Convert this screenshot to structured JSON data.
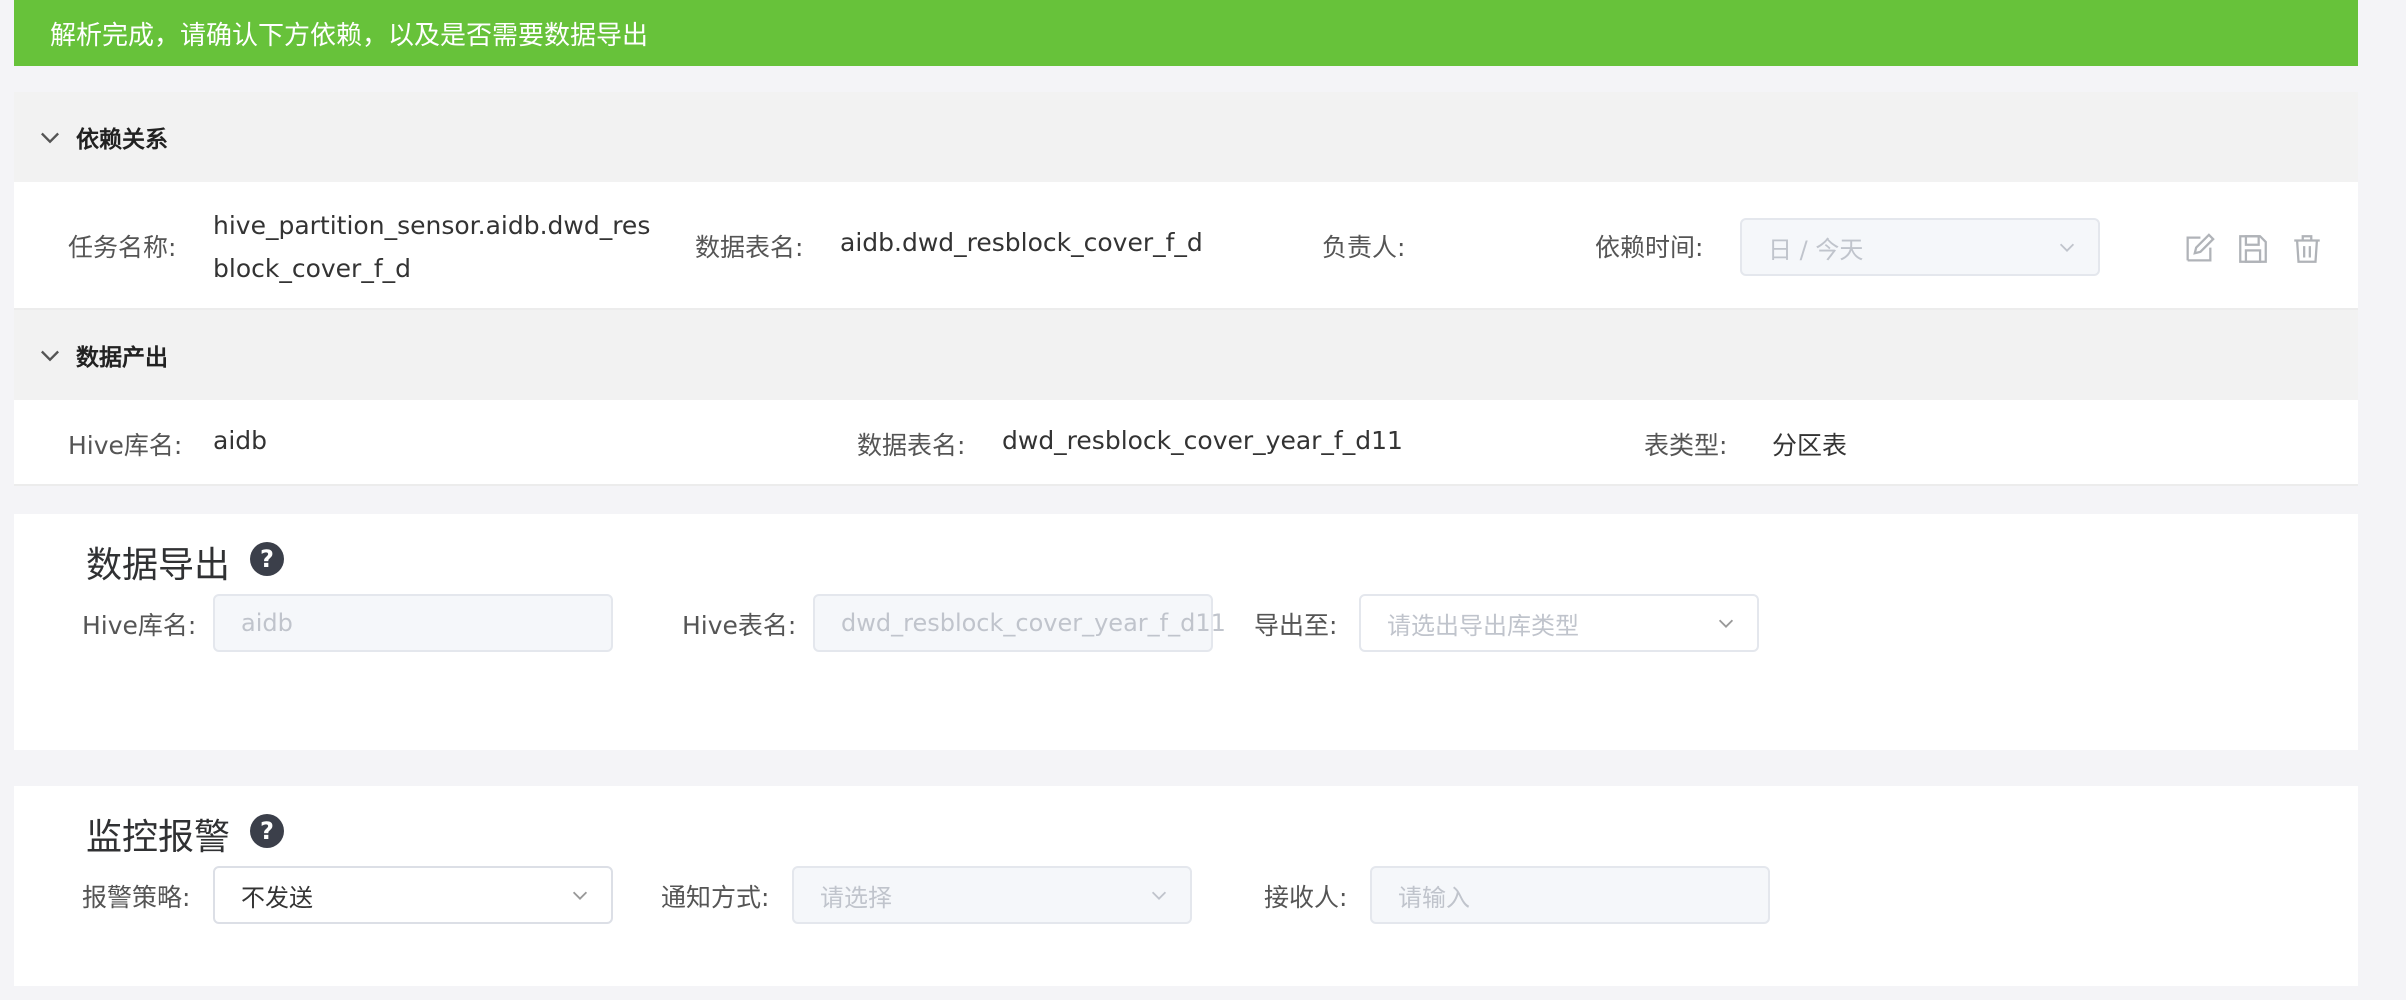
{
  "banner": {
    "text": "解析完成，请确认下方依赖，以及是否需要数据导出"
  },
  "dependency": {
    "title": "依赖关系",
    "task_label": "任务名称:",
    "task_value": "hive_partition_sensor.aidb.dwd_resblock_cover_f_d",
    "table_label": "数据表名:",
    "table_value": "aidb.dwd_resblock_cover_f_d",
    "owner_label": "负责人:",
    "owner_value": "",
    "time_label": "依赖时间:",
    "time_value": "日 / 今天"
  },
  "output": {
    "title": "数据产出",
    "db_label": "Hive库名:",
    "db_value": "aidb",
    "table_label": "数据表名:",
    "table_value": "dwd_resblock_cover_year_f_d11",
    "type_label": "表类型:",
    "type_value": "分区表"
  },
  "export": {
    "title": "数据导出",
    "db_label": "Hive库名:",
    "db_value": "aidb",
    "table_label": "Hive表名:",
    "table_value": "dwd_resblock_cover_year_f_d11",
    "target_label": "导出至:",
    "target_placeholder": "请选出导出库类型"
  },
  "monitor": {
    "title": "监控报警",
    "policy_label": "报警策略:",
    "policy_value": "不发送",
    "notify_label": "通知方式:",
    "notify_placeholder": "请选择",
    "receiver_label": "接收人:",
    "receiver_placeholder": "请输入"
  },
  "icons": {
    "edit": "edit-icon",
    "save": "save-icon",
    "delete": "trash-icon",
    "help": "question-circle-icon",
    "chevron": "chevron-down-icon"
  },
  "colors": {
    "success": "#67c23a",
    "section_bg": "#f2f2f2",
    "help_bg": "#3b3f4a"
  }
}
